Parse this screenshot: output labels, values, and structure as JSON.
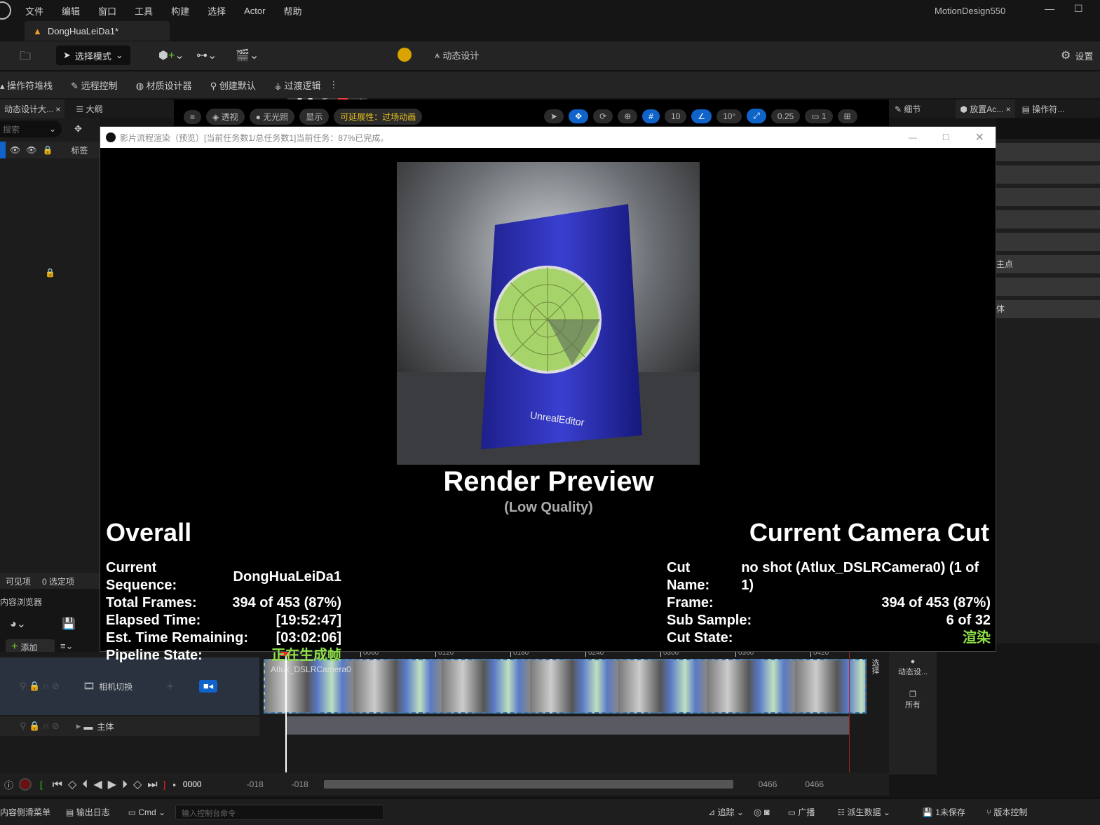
{
  "menu": [
    "文件",
    "编辑",
    "窗口",
    "工具",
    "构建",
    "选择",
    "Actor",
    "帮助"
  ],
  "app_title": "MotionDesign550",
  "doc_tab": "DongHuaLeiDa1*",
  "toolbar": {
    "select_mode": "选择模式",
    "motion_design": "动态设计",
    "settings": "设置"
  },
  "toolbar2": [
    "操作符堆栈",
    "远程控制",
    "材质设计器",
    "创建默认",
    "过渡逻辑"
  ],
  "left_tabs": {
    "tab1": "动态设计大...",
    "tab2": "大纲",
    "search_placeholder": "搜索",
    "label_col": "标签",
    "visible": "可见项",
    "selected": "0 选定项",
    "content_browser": "内容浏览器",
    "add": "添加"
  },
  "viewport": {
    "menu": "≡",
    "perspective": "透视",
    "unlit": "无光照",
    "show": "显示",
    "deferred": "可延展性：过场动画",
    "grid": "10",
    "angle": "10°",
    "scale": "0.25",
    "cam": "1"
  },
  "right_tabs": {
    "details": "细节",
    "place": "放置Ac...",
    "operators": "操作符..."
  },
  "right_rows": [
    "",
    "",
    "",
    "",
    "",
    "主点",
    "",
    "体"
  ],
  "dialog": {
    "title": "影片流程渲染（预览）[当前任务数1/总任务数1]当前任务：87%已完成。",
    "preview_title": "Render Preview",
    "preview_sub": "(Low Quality)",
    "overall": "Overall",
    "camera_cut": "Current Camera Cut",
    "left_stats": [
      {
        "k": "Current Sequence:",
        "v": "DongHuaLeiDa1"
      },
      {
        "k": "Total Frames:",
        "v": "394 of 453 (87%)"
      },
      {
        "k": "Elapsed Time:",
        "v": "[19:52:47]"
      },
      {
        "k": "Est. Time Remaining:",
        "v": "[03:02:06]"
      },
      {
        "k": "Pipeline State:",
        "v": "正在生成帧"
      }
    ],
    "right_stats": [
      {
        "k": "Cut Name:",
        "v": "no shot (Atlux_DSLRCamera0) (1 of 1)"
      },
      {
        "k": "Frame:",
        "v": "394 of 453 (87%)"
      },
      {
        "k": "Sub Sample:",
        "v": "6 of 32"
      },
      {
        "k": "Cut State:",
        "v": "渲染"
      }
    ],
    "image_brand": "UnrealEditor"
  },
  "sequencer": {
    "track_camera": "相机切换",
    "track_body": "主体",
    "clip_label": "Atlux_DSLRCamera0",
    "ticks": [
      "0060",
      "0120",
      "0180",
      "0240",
      "0300",
      "0360",
      "0420"
    ],
    "frame": "0000",
    "range": [
      "-018",
      "-018",
      "0466",
      "0466"
    ],
    "side_vertical": "选择",
    "side_items": [
      "动态设...",
      "所有"
    ]
  },
  "statusbar": {
    "content_drawer": "内容侧滑菜单",
    "output_log": "输出日志",
    "cmd": "Cmd",
    "cmd_placeholder": "输入控制台命令",
    "trace": "追踪",
    "broadcast": "广播",
    "derived": "派生数据",
    "unsaved": "1未保存",
    "source_control": "版本控制"
  },
  "colors": {
    "accent": "#0f63c9",
    "green": "#8fe04a",
    "record": "#e03030"
  }
}
